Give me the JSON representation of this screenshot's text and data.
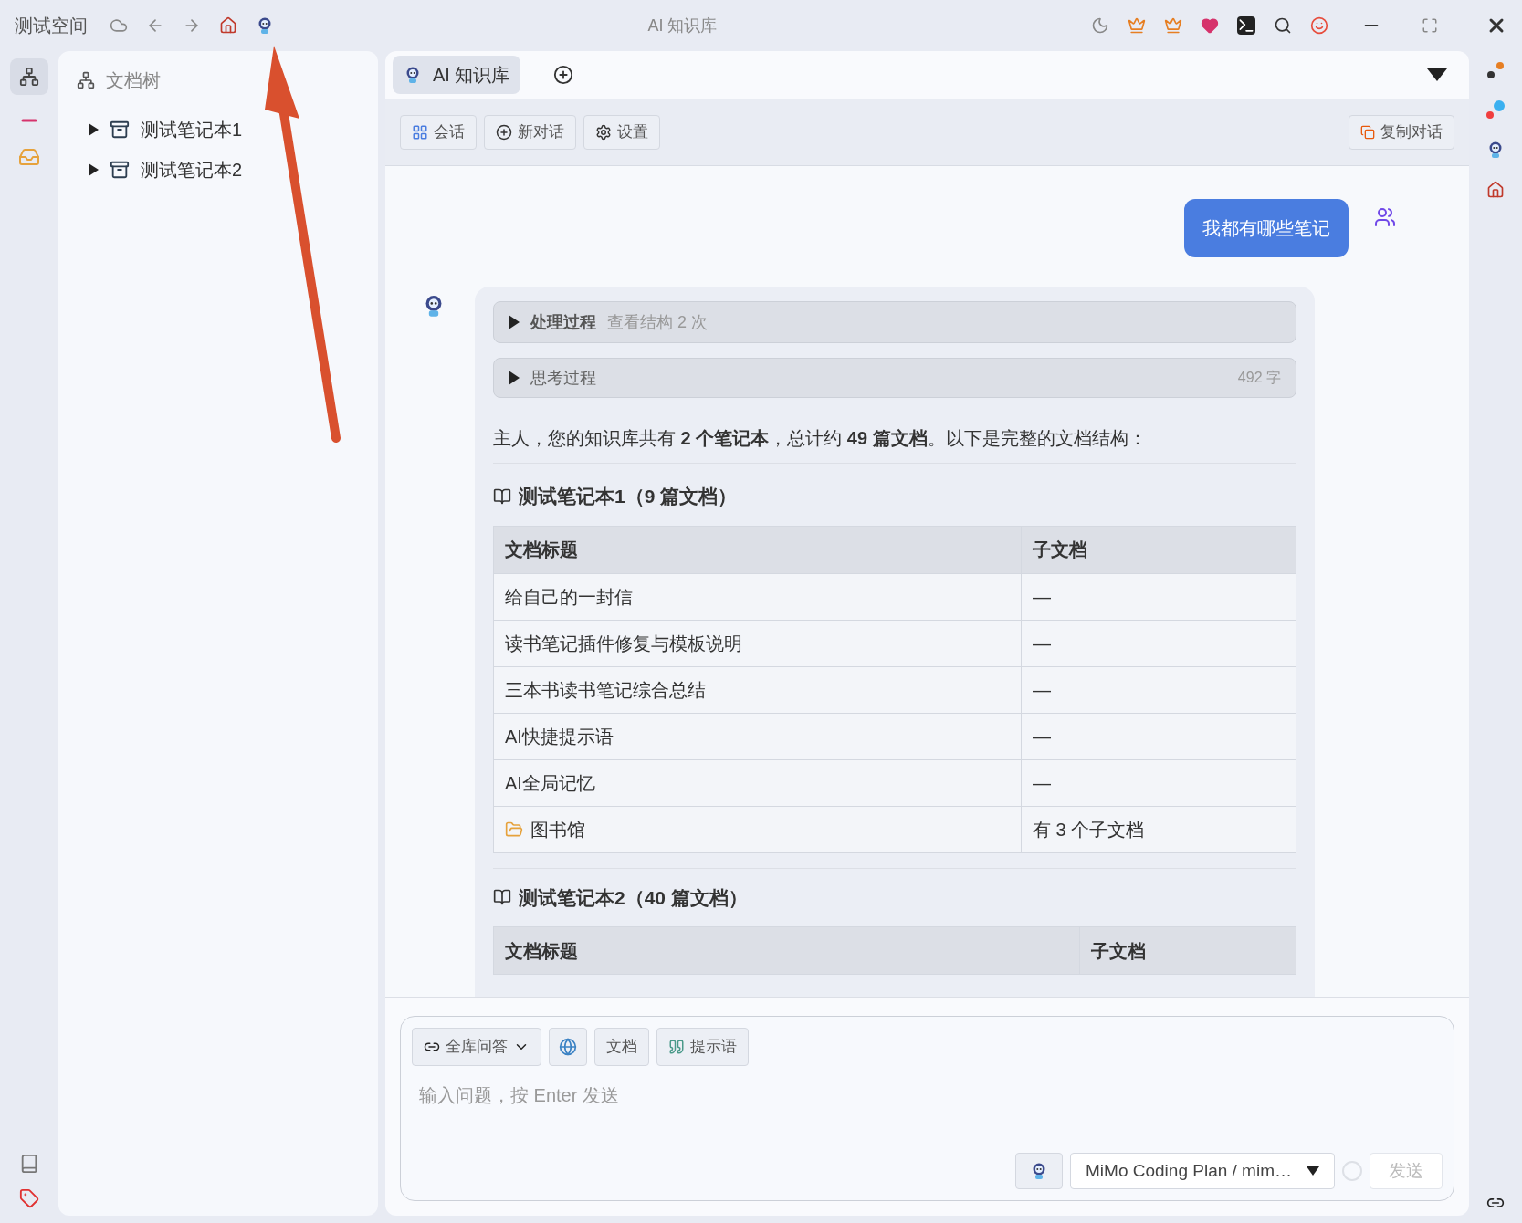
{
  "titlebar": {
    "workspace": "测试空间",
    "title": "AI 知识库"
  },
  "sidebar": {
    "title": "文档树",
    "items": [
      {
        "label": "测试笔记本1",
        "expanded": false
      },
      {
        "label": "测试笔记本2",
        "expanded": false
      }
    ]
  },
  "tabs": [
    {
      "label": "AI 知识库",
      "selected": true
    }
  ],
  "toolbar": {
    "buttons": [
      "会话",
      "新对话",
      "设置"
    ],
    "copy": "复制对话"
  },
  "chat": {
    "user_message": "我都有哪些笔记",
    "steps": [
      {
        "kind": "process",
        "title": "处理过程",
        "detail": "查看结构 2 次",
        "expanded": false
      },
      {
        "kind": "thinking",
        "title": "思考过程",
        "detail": "492 字",
        "expanded": false
      }
    ],
    "summary": "主人，您的知识库共有 **2 个笔记本**，总计约 **49 篇文档**。以下是完整的文档结构：",
    "sections": [
      {
        "heading": "测试笔记本1（9 篇文档）",
        "columns": [
          "文档标题",
          "子文档"
        ],
        "rows": [
          {
            "kind": "doc",
            "title": "给自己的一封信",
            "children": "—"
          },
          {
            "kind": "doc",
            "title": "读书笔记插件修复与模板说明",
            "children": "—"
          },
          {
            "kind": "doc",
            "title": "三本书读书笔记综合总结",
            "children": "—"
          },
          {
            "kind": "doc",
            "title": "AI快捷提示语",
            "children": "—"
          },
          {
            "kind": "doc",
            "title": "AI全局记忆",
            "children": "—"
          },
          {
            "kind": "folder",
            "title": "图书馆",
            "children": "有 3 个子文档"
          }
        ]
      },
      {
        "heading": "测试笔记本2（40 篇文档）",
        "columns": [
          "文档标题",
          "子文档"
        ]
      }
    ]
  },
  "composer": {
    "mode": "全库问答",
    "doc_button": "文档",
    "prompt_button": "提示语",
    "placeholder": "输入问题，按 Enter 发送",
    "model": "MiMo Coding Plan / mim…",
    "send": "发送"
  }
}
